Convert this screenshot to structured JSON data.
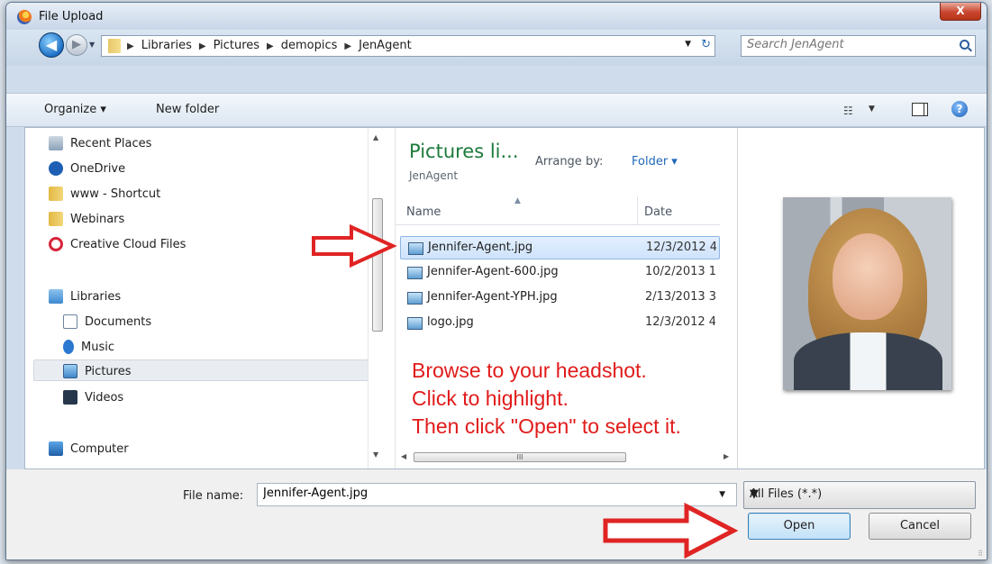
{
  "window": {
    "title": "File Upload",
    "close_label": "X"
  },
  "address": {
    "breadcrumbs": [
      "Libraries",
      "Pictures",
      "demopics",
      "JenAgent"
    ],
    "search_placeholder": "Search JenAgent"
  },
  "toolbar": {
    "organize": "Organize ▾",
    "new_folder": "New folder"
  },
  "nav": {
    "items": [
      {
        "label": "Recent Places",
        "icon": "recent-places-icon"
      },
      {
        "label": "OneDrive",
        "icon": "onedrive-icon"
      },
      {
        "label": "www - Shortcut",
        "icon": "folder-icon"
      },
      {
        "label": "Webinars",
        "icon": "folder-icon"
      },
      {
        "label": "Creative Cloud Files",
        "icon": "creative-cloud-icon"
      },
      {
        "label": "Libraries",
        "icon": "libraries-icon"
      },
      {
        "label": "Documents",
        "icon": "documents-icon"
      },
      {
        "label": "Music",
        "icon": "music-icon"
      },
      {
        "label": "Pictures",
        "icon": "pictures-icon"
      },
      {
        "label": "Videos",
        "icon": "videos-icon"
      },
      {
        "label": "Computer",
        "icon": "computer-icon"
      }
    ],
    "selected": "Pictures"
  },
  "files": {
    "library_title": "Pictures li...",
    "library_subtitle": "JenAgent",
    "arrange_label": "Arrange by:",
    "arrange_value": "Folder ▾",
    "columns": {
      "name": "Name",
      "date": "Date"
    },
    "rows": [
      {
        "name": "Jennifer-Agent.jpg",
        "date": "12/3/2012 4:..."
      },
      {
        "name": "Jennifer-Agent-600.jpg",
        "date": "10/2/2013 1:..."
      },
      {
        "name": "Jennifer-Agent-YPH.jpg",
        "date": "2/13/2013 3:..."
      },
      {
        "name": "logo.jpg",
        "date": "12/3/2012 4:..."
      }
    ],
    "selected_row": 0
  },
  "annotation": {
    "lines": [
      "Browse to your headshot.",
      "Click to highlight.",
      "Then click \"Open\" to select it."
    ],
    "color": "#e11b1b"
  },
  "footer": {
    "file_name_label": "File name:",
    "file_name_value": "Jennifer-Agent.jpg",
    "file_type": "All Files (*.*)",
    "open_label": "Open",
    "cancel_label": "Cancel"
  }
}
